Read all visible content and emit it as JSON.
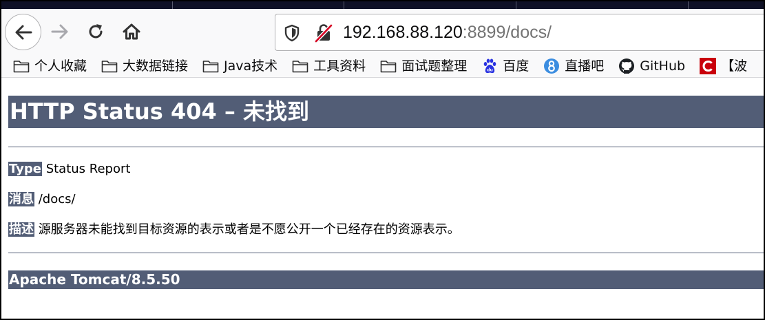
{
  "browser": {
    "url_host": "192.168.88.120",
    "url_rest": ":8899/docs/",
    "nav_icons": [
      "arrow-left-icon",
      "arrow-right-icon",
      "reload-icon",
      "home-icon"
    ],
    "urlbar_icons": [
      "shield-icon",
      "insecure-lock-icon"
    ]
  },
  "bookmarks": [
    {
      "label": "个人收藏",
      "icon": "folder-icon"
    },
    {
      "label": "大数据链接",
      "icon": "folder-icon"
    },
    {
      "label": "Java技术",
      "icon": "folder-icon"
    },
    {
      "label": "工具资料",
      "icon": "folder-icon"
    },
    {
      "label": "面试题整理",
      "icon": "folder-icon"
    },
    {
      "label": "百度",
      "icon": "baidu-paw-icon"
    },
    {
      "label": "直播吧",
      "icon": "zhibo8-icon"
    },
    {
      "label": "GitHub",
      "icon": "github-icon"
    },
    {
      "label": "【波",
      "icon": "csdn-c-icon"
    }
  ],
  "page": {
    "title": "HTTP Status 404 – 未找到",
    "type_label": "Type",
    "type_value": "Status Report",
    "message_label": "消息",
    "message_value": "/docs/",
    "description_label": "描述",
    "description_value": "源服务器未能找到目标资源的表示或者是不愿公开一个已经存在的资源表示。",
    "footer": "Apache Tomcat/8.5.50"
  },
  "colors": {
    "tomcat_header": "#525d76",
    "insecure_slash": "#d70022",
    "baidu_blue": "#2932e1",
    "zhibo8_blue": "#3b8de0",
    "csdn_red": "#c9000b"
  }
}
